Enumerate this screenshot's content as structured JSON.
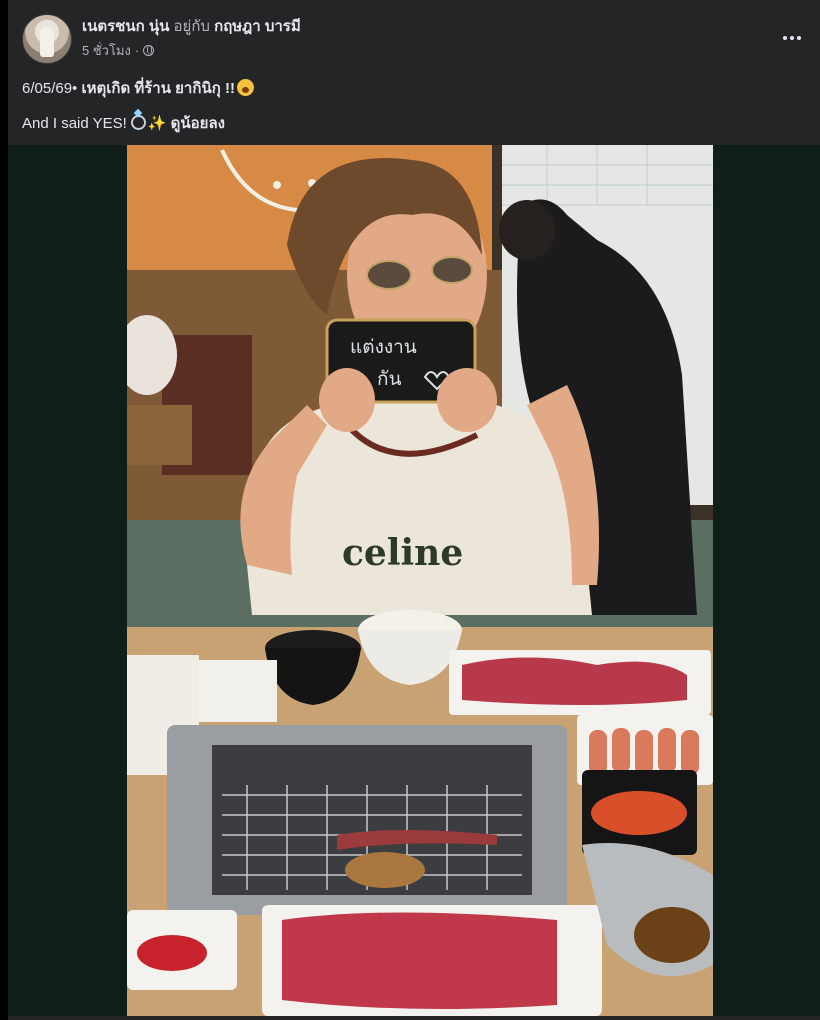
{
  "post": {
    "author_name": "เนตรชนก นุ่น",
    "with_text": "อยู่กับ",
    "tagged_name": "กฤษฎา บารมี",
    "timestamp": "5 ชั่วโมง",
    "caption_line1_date": "6/05/69•",
    "caption_line1_text": "เหตุเกิด ที่ร้าน ยากินิกุ !!",
    "caption_line2_text": "And I said YES!",
    "caption_line2_tag": "ดูน้อยลง",
    "photo_sign_line1": "แต่งงาน",
    "photo_sign_line2": "กัน",
    "photo_shirt_text": "celine",
    "icons": {
      "privacy": "globe-icon",
      "more": "more-options-icon",
      "face": "face-with-open-mouth-emoji",
      "ring": "ring-emoji",
      "sparkles": "sparkles-emoji"
    },
    "colors": {
      "card_bg": "#242526",
      "text_primary": "#e4e6eb",
      "text_secondary": "#b0b3b8",
      "media_bg": "#0f1e18"
    }
  }
}
